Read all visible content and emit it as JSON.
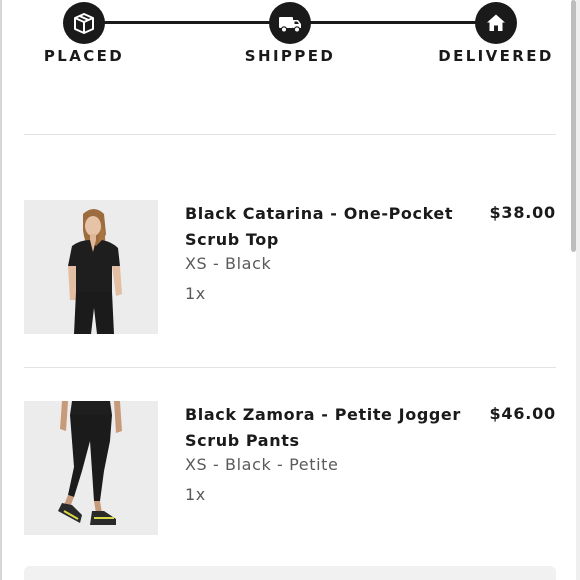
{
  "tracker": {
    "steps": [
      {
        "label": "PLACED",
        "icon": "package-icon"
      },
      {
        "label": "SHIPPED",
        "icon": "truck-icon"
      },
      {
        "label": "DELIVERED",
        "icon": "home-icon"
      }
    ]
  },
  "items": [
    {
      "name": "Black Catarina - One-Pocket Scrub Top",
      "variant": "XS - Black",
      "quantity": "1x",
      "price": "$38.00",
      "image": "scrub-top-photo"
    },
    {
      "name": "Black Zamora - Petite Jogger Scrub Pants",
      "variant": "XS - Black - Petite",
      "quantity": "1x",
      "price": "$46.00",
      "image": "scrub-pants-photo"
    }
  ],
  "colors": {
    "text_primary": "#1a1a1a",
    "text_secondary": "#5a5a5a",
    "divider": "#e2e2e2",
    "thumb_bg": "#ebebeb"
  }
}
